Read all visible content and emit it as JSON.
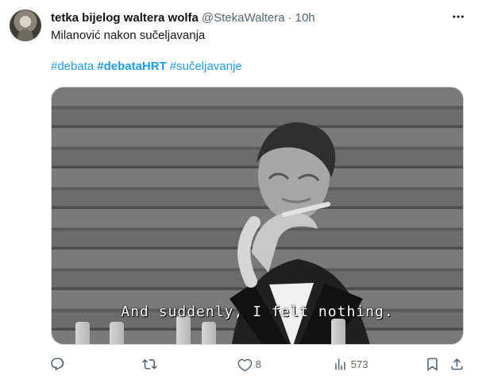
{
  "tweet": {
    "display_name": "tetka bijelog waltera wolfa",
    "handle": "@StekaWaltera",
    "separator": "·",
    "time": "10h",
    "text": "Milanović nakon sučeljavanja",
    "hashtags": [
      "#debata",
      "#debataHRT",
      "#sučeljavanje"
    ],
    "media_caption": "And suddenly, I felt nothing.",
    "actions": {
      "reply": "",
      "retweet": "",
      "likes": "8",
      "views": "573"
    }
  },
  "icons": {
    "avatar": "avatar",
    "more": "more-icon",
    "reply": "reply-icon",
    "retweet": "retweet-icon",
    "like": "heart-icon",
    "views": "views-icon",
    "bookmark": "bookmark-icon",
    "share": "share-icon"
  },
  "colors": {
    "link": "#1d9bf0",
    "muted": "#536471",
    "text": "#0f1419"
  }
}
